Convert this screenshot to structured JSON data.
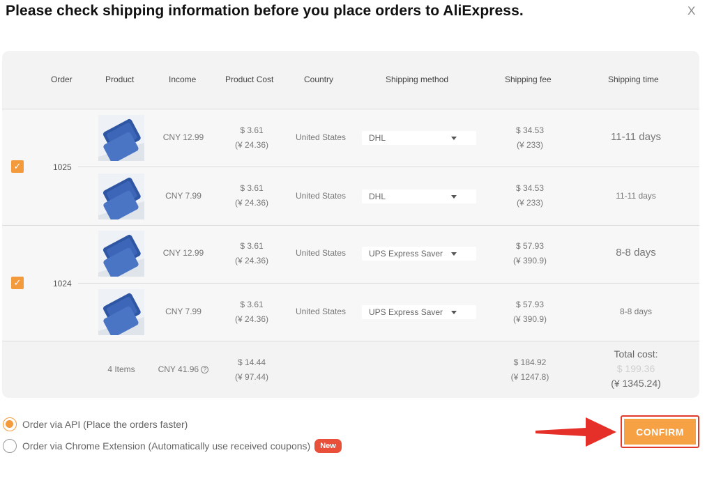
{
  "dialog": {
    "title": "Please check shipping information before you place orders to AliExpress.",
    "close_label": "X"
  },
  "table": {
    "headers": {
      "order": "Order",
      "product": "Product",
      "income": "Income",
      "product_cost": "Product Cost",
      "country": "Country",
      "shipping_method": "Shipping method",
      "shipping_fee": "Shipping fee",
      "shipping_time": "Shipping time"
    },
    "orders": [
      {
        "order_no": "1025",
        "checked": true,
        "items": [
          {
            "income": "CNY 12.99",
            "cost_usd": "$ 3.61",
            "cost_cny": "(¥ 24.36)",
            "country": "United States",
            "shipping_method": "DHL",
            "fee_usd": "$ 34.53",
            "fee_cny": "(¥ 233)",
            "shipping_time": "11-11 days"
          },
          {
            "income": "CNY 7.99",
            "cost_usd": "$ 3.61",
            "cost_cny": "(¥ 24.36)",
            "country": "United States",
            "shipping_method": "DHL",
            "fee_usd": "$ 34.53",
            "fee_cny": "(¥ 233)",
            "shipping_time": "11-11 days"
          }
        ]
      },
      {
        "order_no": "1024",
        "checked": true,
        "items": [
          {
            "income": "CNY 12.99",
            "cost_usd": "$ 3.61",
            "cost_cny": "(¥ 24.36)",
            "country": "United States",
            "shipping_method": "UPS Express Saver",
            "fee_usd": "$ 57.93",
            "fee_cny": "(¥ 390.9)",
            "shipping_time": "8-8 days"
          },
          {
            "income": "CNY 7.99",
            "cost_usd": "$ 3.61",
            "cost_cny": "(¥ 24.36)",
            "country": "United States",
            "shipping_method": "UPS Express Saver",
            "fee_usd": "$ 57.93",
            "fee_cny": "(¥ 390.9)",
            "shipping_time": "8-8 days"
          }
        ]
      }
    ],
    "summary": {
      "items": "4 Items",
      "income": "CNY 41.96",
      "cost_usd": "$ 14.44",
      "cost_cny": "(¥ 97.44)",
      "fee_usd": "$ 184.92",
      "fee_cny": "(¥ 1247.8)",
      "total_label": "Total cost:",
      "total_usd": "$ 199.36",
      "total_cny": "(¥ 1345.24)"
    }
  },
  "options": {
    "api": {
      "label": "Order via API (Place the orders faster)",
      "selected": true
    },
    "extension": {
      "label": "Order via Chrome Extension (Automatically use received coupons)",
      "selected": false,
      "badge": "New"
    }
  },
  "confirm_label": "CONFIRM",
  "icons": {
    "info": "info-circle-icon",
    "check": "checkmark-icon",
    "arrow": "red-arrow-icon"
  },
  "colors": {
    "accent": "#f39a3c",
    "badge": "#e9503a",
    "highlight": "#e23a2a",
    "button": "#f6a143"
  }
}
